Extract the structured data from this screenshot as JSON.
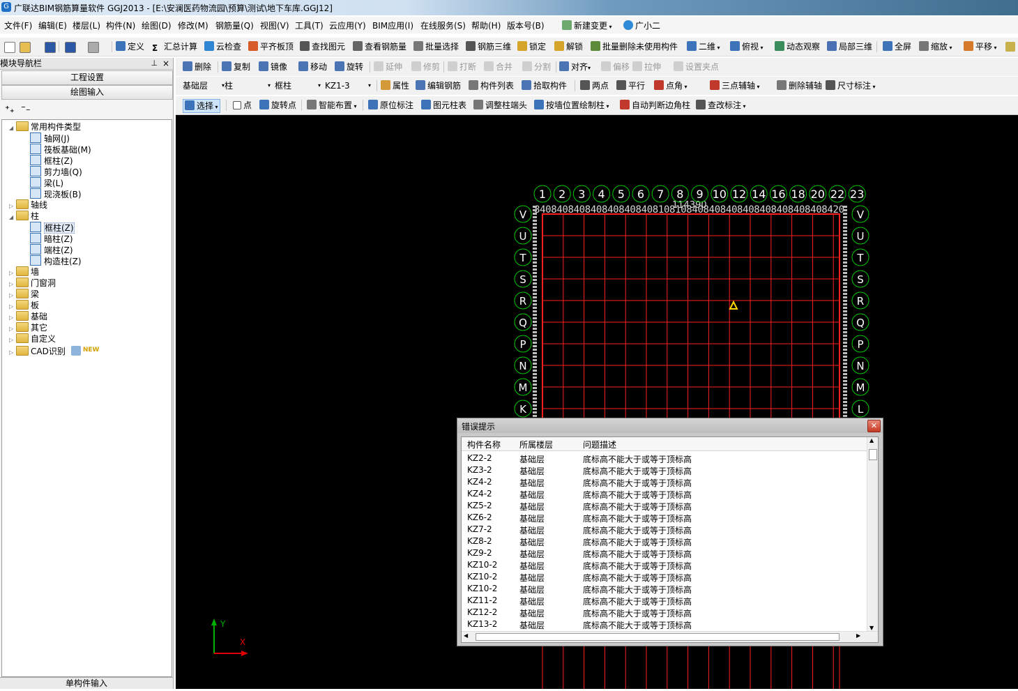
{
  "window": {
    "title": "广联达BIM钢筋算量软件 GGJ2013 - [E:\\安澜医药物流园\\预算\\测试\\地下车库.GGJ12]"
  },
  "menu": [
    "文件(F)",
    "编辑(E)",
    "楼层(L)",
    "构件(N)",
    "绘图(D)",
    "修改(M)",
    "钢筋量(Q)",
    "视图(V)",
    "工具(T)",
    "云应用(Y)",
    "BIM应用(I)",
    "在线服务(S)",
    "帮助(H)",
    "版本号(B)",
    "新建变更",
    "广小二"
  ],
  "toolbar1": [
    "定义",
    "汇总计算",
    "云检查",
    "平齐板顶",
    "查找图元",
    "查看钢筋量",
    "批量选择",
    "钢筋三维",
    "锁定",
    "解锁",
    "批量删除未使用构件",
    "二维",
    "俯视",
    "动态观察",
    "局部三维",
    "全屏",
    "缩放",
    "平移"
  ],
  "toolbar2": [
    "删除",
    "复制",
    "镜像",
    "移动",
    "旋转",
    "延伸",
    "修剪",
    "打断",
    "合并",
    "分割",
    "对齐",
    "偏移",
    "拉伸",
    "设置夹点"
  ],
  "toolbar3": {
    "floor": "基础层",
    "category": "柱",
    "type": "框柱",
    "component": "KZ1-3",
    "buttons": [
      "属性",
      "编辑钢筋",
      "构件列表",
      "拾取构件",
      "两点",
      "平行",
      "点角",
      "三点辅轴",
      "删除辅轴",
      "尺寸标注"
    ]
  },
  "toolbar4": [
    "选择",
    "点",
    "旋转点",
    "智能布置",
    "原位标注",
    "图元柱表",
    "调整柱端头",
    "按墙位置绘制柱",
    "自动判断边角柱",
    "查改标注"
  ],
  "nav": {
    "title": "模块导航栏",
    "btn_project": "工程设置",
    "btn_draw": "绘图输入",
    "bottom": "单构件输入",
    "tree": [
      {
        "label": "常用构件类型",
        "level": 0,
        "kind": "folder",
        "open": true
      },
      {
        "label": "轴网(J)",
        "level": 1,
        "kind": "item"
      },
      {
        "label": "筏板基础(M)",
        "level": 1,
        "kind": "item"
      },
      {
        "label": "框柱(Z)",
        "level": 1,
        "kind": "item"
      },
      {
        "label": "剪力墙(Q)",
        "level": 1,
        "kind": "item"
      },
      {
        "label": "梁(L)",
        "level": 1,
        "kind": "item"
      },
      {
        "label": "现浇板(B)",
        "level": 1,
        "kind": "item"
      },
      {
        "label": "轴线",
        "level": 0,
        "kind": "folder",
        "open": false
      },
      {
        "label": "柱",
        "level": 0,
        "kind": "folder",
        "open": true
      },
      {
        "label": "框柱(Z)",
        "level": 1,
        "kind": "item",
        "selected": true
      },
      {
        "label": "暗柱(Z)",
        "level": 1,
        "kind": "item"
      },
      {
        "label": "端柱(Z)",
        "level": 1,
        "kind": "item"
      },
      {
        "label": "构造柱(Z)",
        "level": 1,
        "kind": "item"
      },
      {
        "label": "墙",
        "level": 0,
        "kind": "folder",
        "open": false
      },
      {
        "label": "门窗洞",
        "level": 0,
        "kind": "folder",
        "open": false
      },
      {
        "label": "梁",
        "level": 0,
        "kind": "folder",
        "open": false
      },
      {
        "label": "板",
        "level": 0,
        "kind": "folder",
        "open": false
      },
      {
        "label": "基础",
        "level": 0,
        "kind": "folder",
        "open": false
      },
      {
        "label": "其它",
        "level": 0,
        "kind": "folder",
        "open": false
      },
      {
        "label": "自定义",
        "level": 0,
        "kind": "folder",
        "open": false
      },
      {
        "label": "CAD识别",
        "level": 0,
        "kind": "folder",
        "open": false,
        "badge": "NEW"
      }
    ]
  },
  "grid": {
    "top_axes": [
      "1",
      "2",
      "3",
      "4",
      "5",
      "6",
      "7",
      "8",
      "9",
      "10",
      "12",
      "14",
      "16",
      "18",
      "20",
      "22",
      "23"
    ],
    "side_axes_left": [
      "V",
      "U",
      "T",
      "S",
      "R",
      "Q",
      "P",
      "N",
      "M",
      "K"
    ],
    "side_axes_right": [
      "V",
      "U",
      "T",
      "S",
      "R",
      "Q",
      "P",
      "N",
      "M",
      "L"
    ],
    "top_dims": "8408408408408408408408108108408408408408408408408408420",
    "overall_dim": "114390",
    "line_color": "#ff1f1f",
    "bubble_color": "#00c800"
  },
  "axis_indicator": {
    "x": "X",
    "y": "Y"
  },
  "dialog": {
    "title": "错误提示",
    "columns": [
      "构件名称",
      "所属楼层",
      "问题描述"
    ],
    "rows": [
      [
        "KZ2-2",
        "基础层",
        "底标高不能大于或等于顶标高"
      ],
      [
        "KZ3-2",
        "基础层",
        "底标高不能大于或等于顶标高"
      ],
      [
        "KZ4-2",
        "基础层",
        "底标高不能大于或等于顶标高"
      ],
      [
        "KZ4-2",
        "基础层",
        "底标高不能大于或等于顶标高"
      ],
      [
        "KZ5-2",
        "基础层",
        "底标高不能大于或等于顶标高"
      ],
      [
        "KZ6-2",
        "基础层",
        "底标高不能大于或等于顶标高"
      ],
      [
        "KZ7-2",
        "基础层",
        "底标高不能大于或等于顶标高"
      ],
      [
        "KZ8-2",
        "基础层",
        "底标高不能大于或等于顶标高"
      ],
      [
        "KZ9-2",
        "基础层",
        "底标高不能大于或等于顶标高"
      ],
      [
        "KZ10-2",
        "基础层",
        "底标高不能大于或等于顶标高"
      ],
      [
        "KZ10-2",
        "基础层",
        "底标高不能大于或等于顶标高"
      ],
      [
        "KZ10-2",
        "基础层",
        "底标高不能大于或等于顶标高"
      ],
      [
        "KZ11-2",
        "基础层",
        "底标高不能大于或等于顶标高"
      ],
      [
        "KZ12-2",
        "基础层",
        "底标高不能大于或等于顶标高"
      ],
      [
        "KZ13-2",
        "基础层",
        "底标高不能大于或等于顶标高"
      ]
    ]
  }
}
